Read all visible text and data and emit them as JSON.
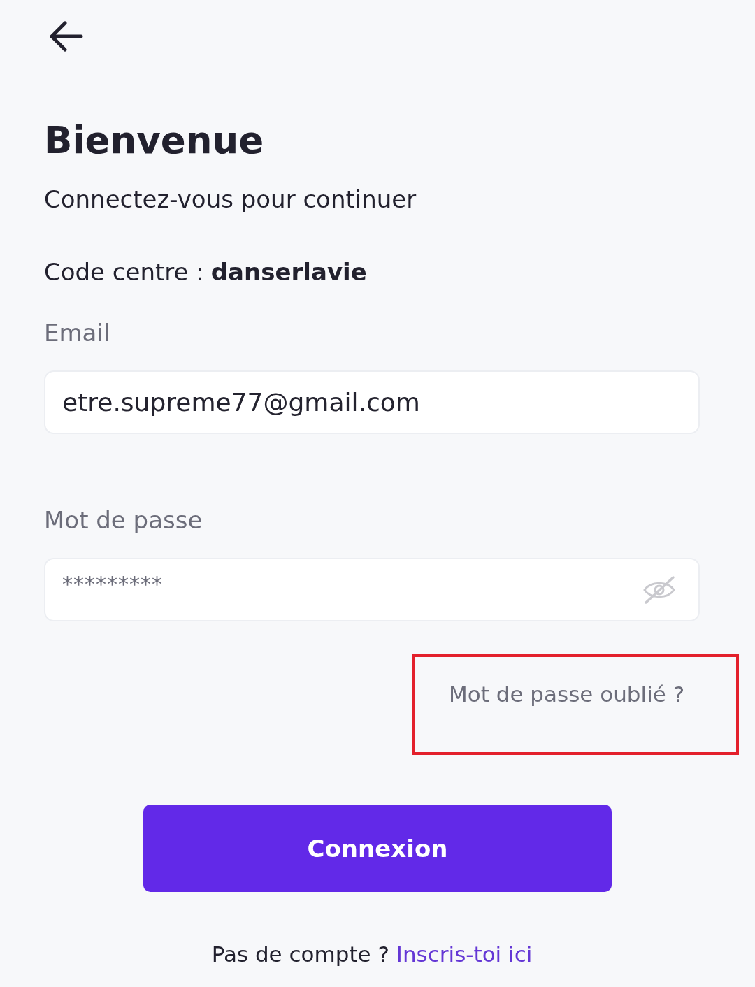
{
  "header": {
    "title": "Bienvenue",
    "subtitle": "Connectez-vous pour continuer"
  },
  "centre_code": {
    "label": "Code centre :",
    "value": "danserlavie"
  },
  "email": {
    "label": "Email",
    "value": "etre.supreme77@gmail.com"
  },
  "password": {
    "label": "Mot de passe",
    "value": "*********",
    "revealed": false
  },
  "forgot_password": {
    "label": "Mot de passe oublié ?",
    "highlighted": true
  },
  "login_button": {
    "label": "Connexion"
  },
  "signup": {
    "prompt": "Pas de compte ?",
    "link": "Inscris-toi ici"
  }
}
